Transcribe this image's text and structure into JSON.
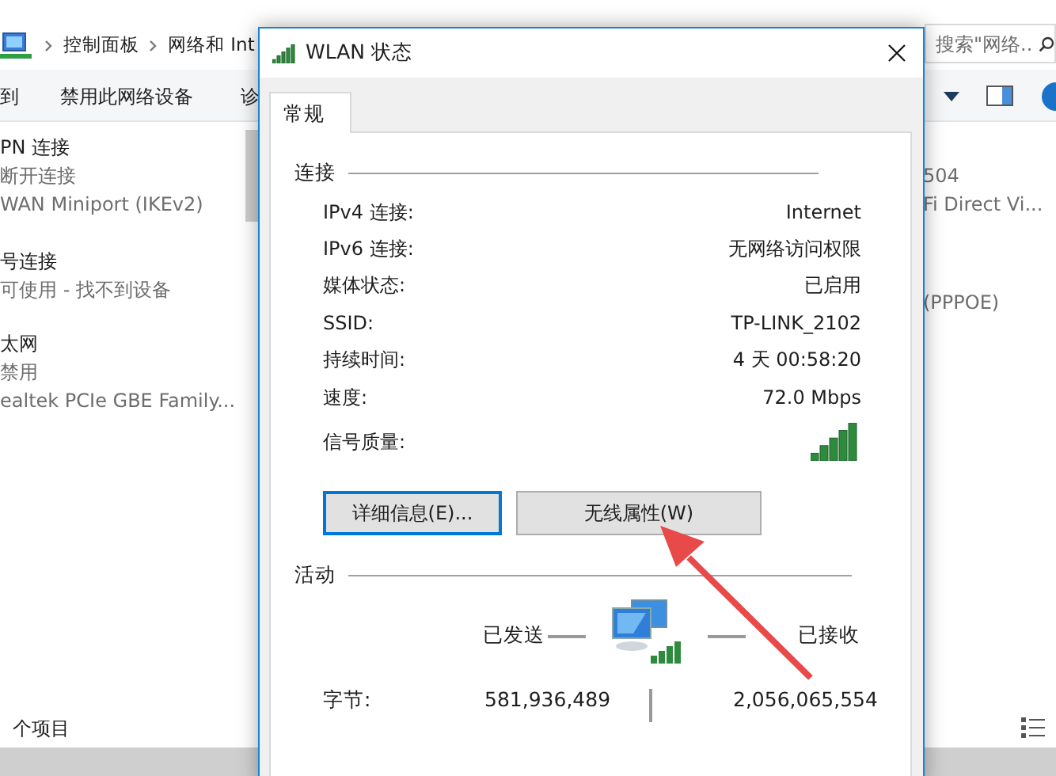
{
  "explorer": {
    "breadcrumb": [
      "控制面板",
      "网络和 Int"
    ],
    "search": {
      "placeholder": "搜索\"网络..."
    },
    "toolbar": [
      "到",
      "禁用此网络设备",
      "诊"
    ],
    "connections_left": [
      {
        "name": "PN 连接",
        "status": "断开连接",
        "device": "WAN Miniport (IKEv2)"
      },
      {
        "name": "号连接",
        "status": "可使用 - 找不到设备"
      },
      {
        "name": "太网",
        "status": "禁用",
        "device": "ealtek PCIe GBE Family..."
      }
    ],
    "connections_right": [
      {
        "lines": [
          "504",
          "Fi Direct Vi..."
        ]
      },
      {
        "lines": [
          "(PPPOE)"
        ]
      }
    ],
    "status_bar": "个项目"
  },
  "dialog": {
    "title": "WLAN 状态",
    "tabs": [
      {
        "label": "常规",
        "selected": true
      }
    ],
    "connection": {
      "heading": "连接",
      "rows": [
        {
          "label": "IPv4 连接:",
          "value": "Internet"
        },
        {
          "label": "IPv6 连接:",
          "value": "无网络访问权限"
        },
        {
          "label": "媒体状态:",
          "value": "已启用"
        },
        {
          "label": "SSID:",
          "value": "TP-LINK_2102"
        },
        {
          "label": "持续时间:",
          "value": "4 天 00:58:20"
        },
        {
          "label": "速度:",
          "value": "72.0 Mbps"
        }
      ],
      "signal_label": "信号质量:"
    },
    "buttons": [
      {
        "label": "详细信息(E)...",
        "focused": true
      },
      {
        "label": "无线属性(W)",
        "focused": false
      }
    ],
    "activity": {
      "heading": "活动",
      "sent_label": "已发送",
      "received_label": "已接收",
      "bytes_label": "字节:",
      "sent": "581,936,489",
      "received": "2,056,065,554"
    }
  }
}
